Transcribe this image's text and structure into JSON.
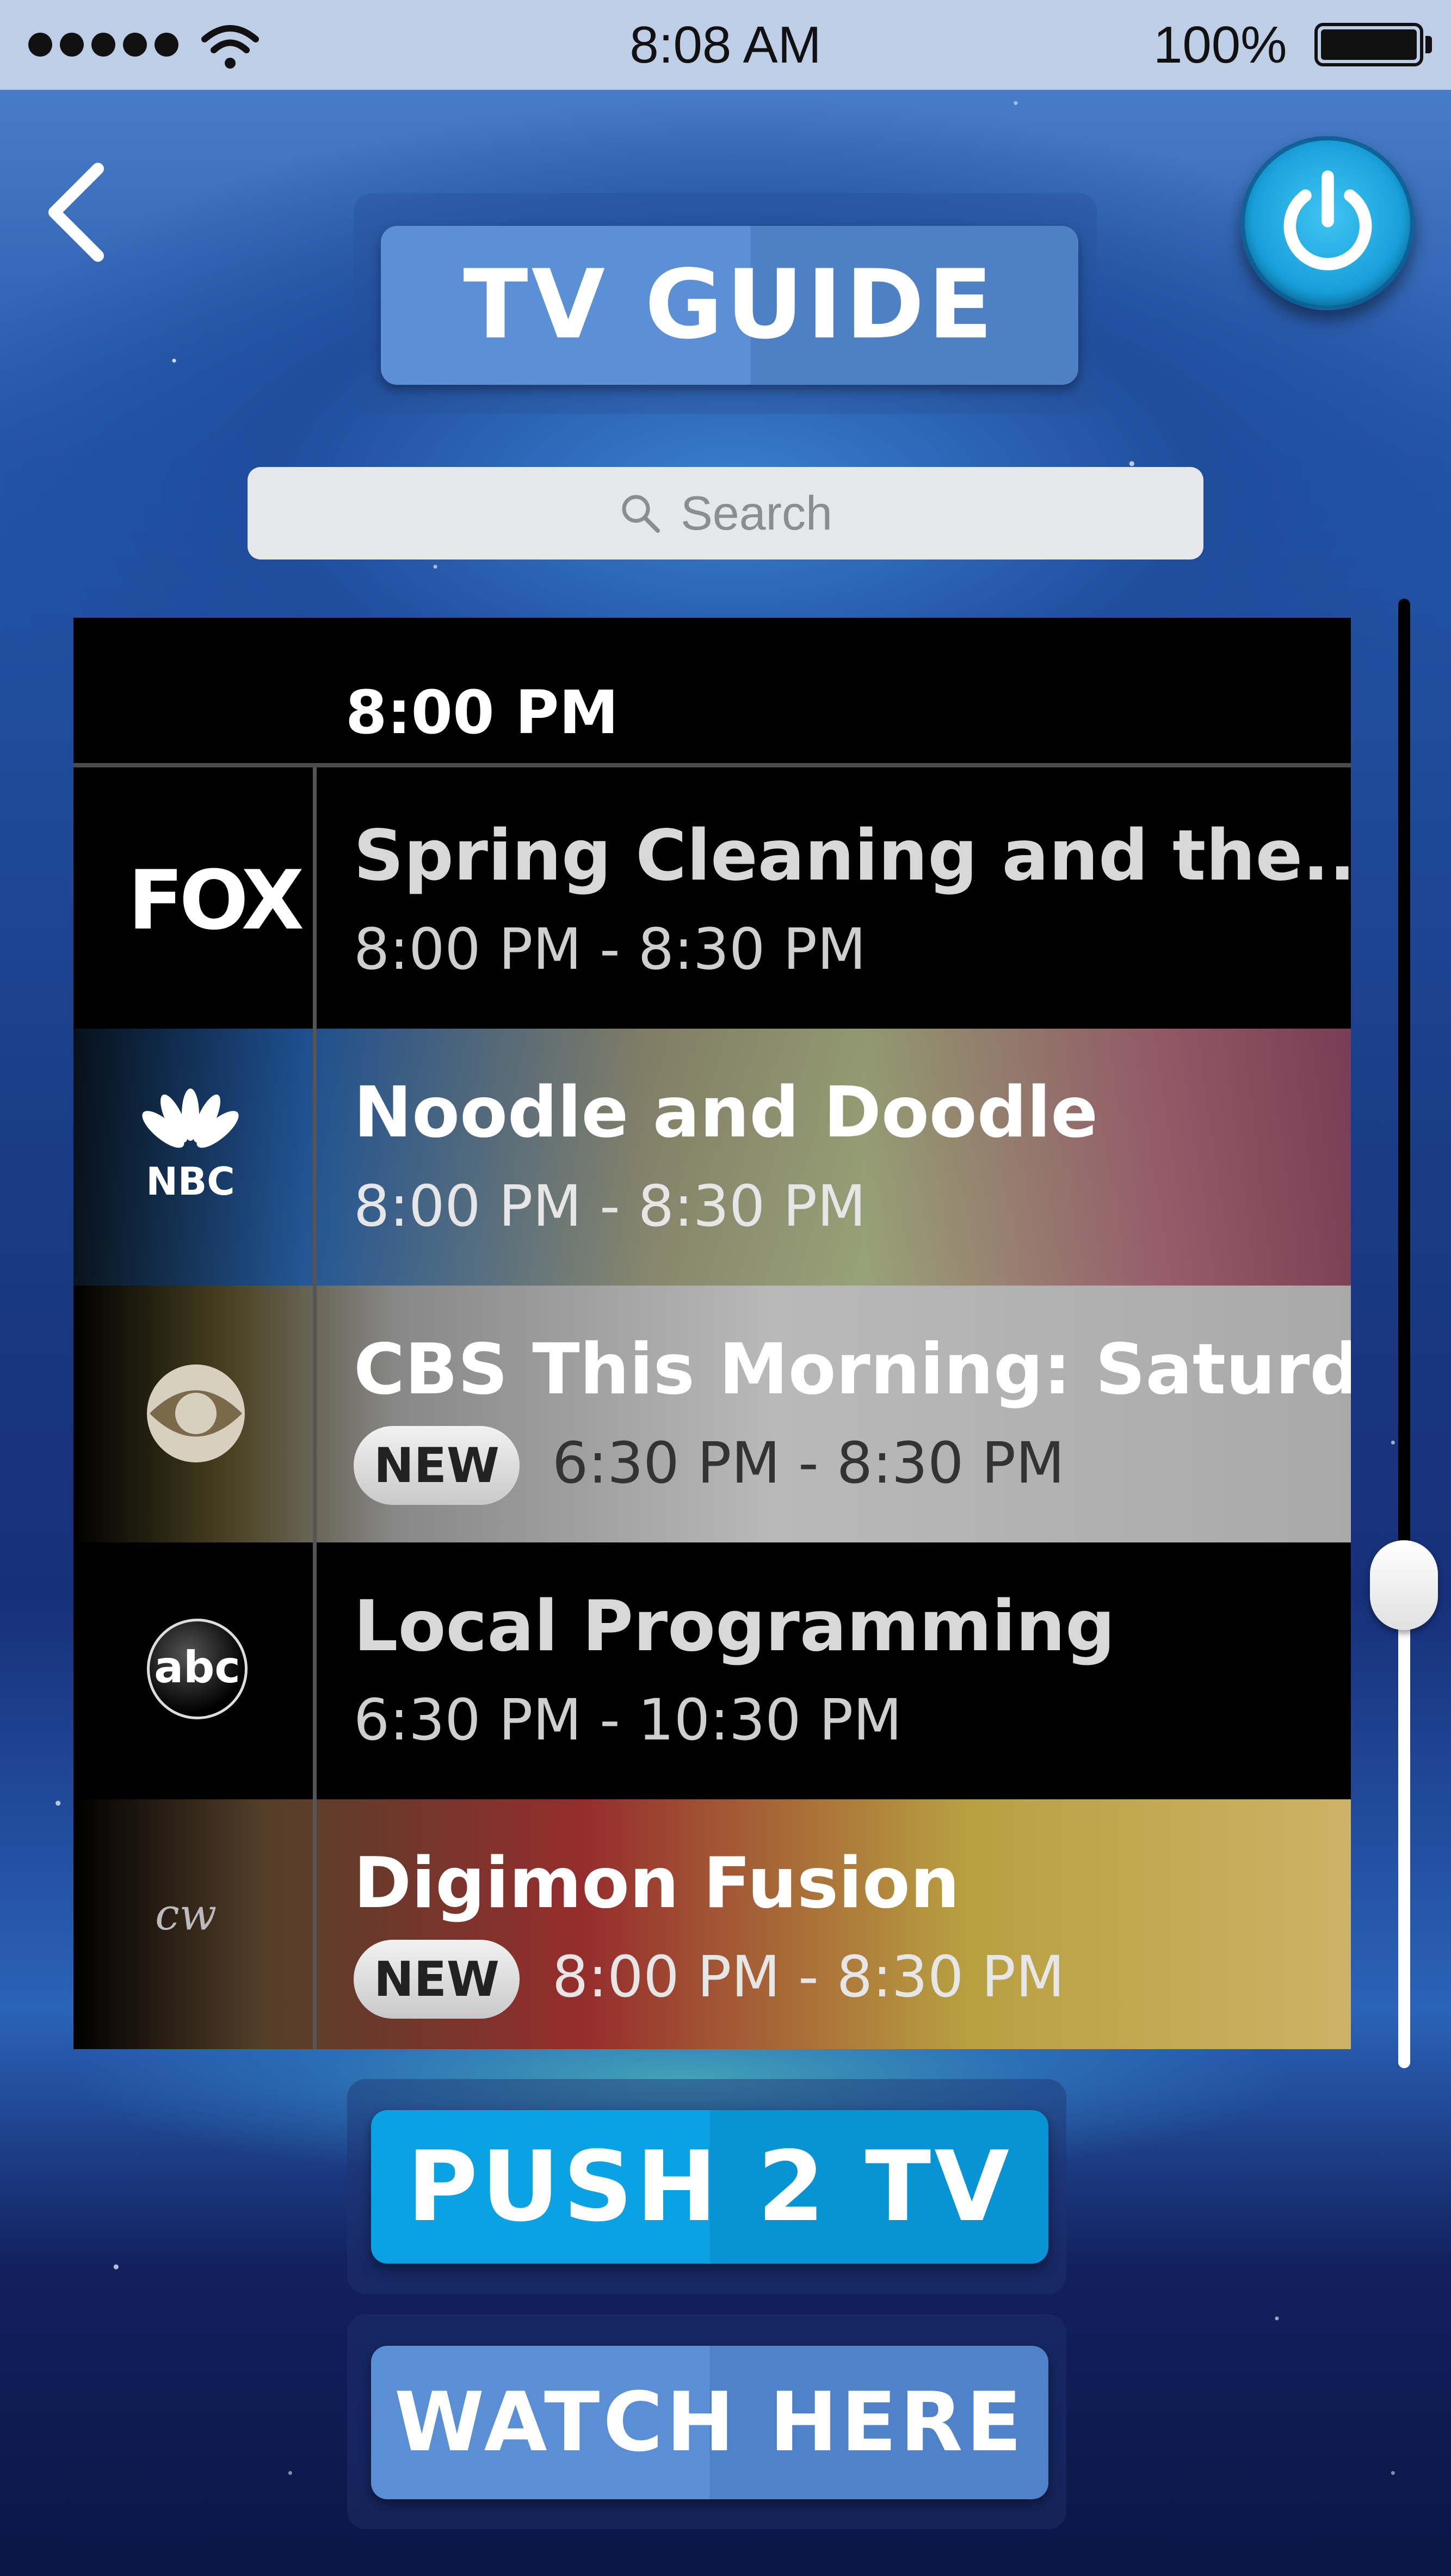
{
  "status_bar": {
    "time": "8:08 AM",
    "battery": "100%"
  },
  "header": {
    "title": "TV GUIDE"
  },
  "search": {
    "placeholder": "Search"
  },
  "guide": {
    "current_time": "8:00 PM",
    "rows": [
      {
        "channel": "FOX",
        "title": "Spring Cleaning and the...",
        "time": "8:00 PM - 8:30 PM",
        "badge": ""
      },
      {
        "channel": "NBC",
        "title": "Noodle and Doodle",
        "time": "8:00 PM - 8:30 PM",
        "badge": ""
      },
      {
        "channel": "CBS",
        "title": "CBS This Morning: Saturd...",
        "time": "6:30 PM - 8:30 PM",
        "badge": "NEW"
      },
      {
        "channel": "abc",
        "title": "Local Programming",
        "time": "6:30 PM - 10:30 PM",
        "badge": ""
      },
      {
        "channel": "cw",
        "title": "Digimon Fusion",
        "time": "8:00 PM - 8:30 PM",
        "badge": "NEW"
      }
    ]
  },
  "slider": {
    "position_fraction": 0.66
  },
  "actions": {
    "push_label": "PUSH 2 TV",
    "watch_label": "WATCH HERE"
  },
  "colors": {
    "accent_blue": "#0aa2e2",
    "button_blue": "#5b8fd6",
    "power_blue": "#3ec5f2"
  },
  "icons": [
    "signal-dots-icon",
    "wifi-icon",
    "battery-icon",
    "back-chevron-icon",
    "power-icon",
    "search-icon"
  ]
}
